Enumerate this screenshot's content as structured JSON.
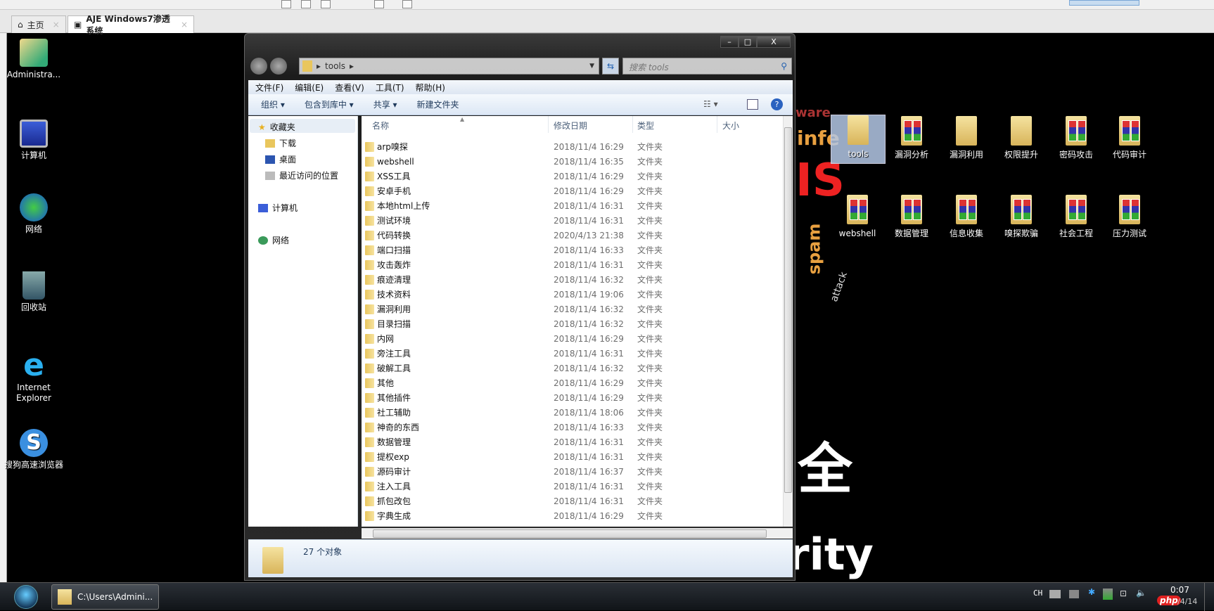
{
  "host": {
    "tabs": [
      {
        "label": "主页",
        "icon": "home-icon"
      },
      {
        "label": "AJE Windows7渗透系统",
        "icon": "vm-icon"
      }
    ]
  },
  "desktop_left": [
    {
      "label": "Administra..."
    },
    {
      "label": "计算机"
    },
    {
      "label": "网络"
    },
    {
      "label": "回收站"
    },
    {
      "label": "Internet Explorer"
    },
    {
      "label": "搜狗高速浏览器"
    }
  ],
  "desktop_right": [
    {
      "label": "tools",
      "selected": true
    },
    {
      "label": "漏洞分析"
    },
    {
      "label": "漏洞利用"
    },
    {
      "label": "权限提升"
    },
    {
      "label": "密码攻击"
    },
    {
      "label": "代码审计"
    },
    {
      "label": "webshell"
    },
    {
      "label": "数据管理"
    },
    {
      "label": "信息收集"
    },
    {
      "label": "嗅探欺骗"
    },
    {
      "label": "社会工程"
    },
    {
      "label": "压力测试"
    }
  ],
  "wallpaper": {
    "big_char": "全",
    "word": "rity",
    "cloud": [
      "infe",
      "IS",
      "spam",
      "attack",
      "ware"
    ]
  },
  "explorer": {
    "window_controls": {
      "minimize": "–",
      "maximize": "□",
      "close": "X"
    },
    "address": {
      "path": "tools",
      "separator": "▸"
    },
    "search_placeholder": "搜索 tools",
    "menu": [
      "文件(F)",
      "编辑(E)",
      "查看(V)",
      "工具(T)",
      "帮助(H)"
    ],
    "commands": [
      "组织 ▾",
      "包含到库中 ▾",
      "共享 ▾",
      "新建文件夹"
    ],
    "nav": {
      "favorites": "收藏夹",
      "items": [
        "下载",
        "桌面",
        "最近访问的位置"
      ],
      "computer": "计算机",
      "network": "网络"
    },
    "columns": [
      "名称",
      "修改日期",
      "类型",
      "大小"
    ],
    "files": [
      {
        "name": "arp嗅探",
        "date": "2018/11/4 16:29",
        "type": "文件夹"
      },
      {
        "name": "webshell",
        "date": "2018/11/4 16:35",
        "type": "文件夹"
      },
      {
        "name": "XSS工具",
        "date": "2018/11/4 16:29",
        "type": "文件夹"
      },
      {
        "name": "安卓手机",
        "date": "2018/11/4 16:29",
        "type": "文件夹"
      },
      {
        "name": "本地html上传",
        "date": "2018/11/4 16:31",
        "type": "文件夹"
      },
      {
        "name": "测试环境",
        "date": "2018/11/4 16:31",
        "type": "文件夹"
      },
      {
        "name": "代码转换",
        "date": "2020/4/13 21:38",
        "type": "文件夹"
      },
      {
        "name": "端口扫描",
        "date": "2018/11/4 16:33",
        "type": "文件夹"
      },
      {
        "name": "攻击轰炸",
        "date": "2018/11/4 16:31",
        "type": "文件夹"
      },
      {
        "name": "痕迹清理",
        "date": "2018/11/4 16:32",
        "type": "文件夹"
      },
      {
        "name": "技术资料",
        "date": "2018/11/4 19:06",
        "type": "文件夹"
      },
      {
        "name": "漏洞利用",
        "date": "2018/11/4 16:32",
        "type": "文件夹"
      },
      {
        "name": "目录扫描",
        "date": "2018/11/4 16:32",
        "type": "文件夹"
      },
      {
        "name": "内网",
        "date": "2018/11/4 16:29",
        "type": "文件夹"
      },
      {
        "name": "旁注工具",
        "date": "2018/11/4 16:31",
        "type": "文件夹"
      },
      {
        "name": "破解工具",
        "date": "2018/11/4 16:32",
        "type": "文件夹"
      },
      {
        "name": "其他",
        "date": "2018/11/4 16:29",
        "type": "文件夹"
      },
      {
        "name": "其他插件",
        "date": "2018/11/4 16:29",
        "type": "文件夹"
      },
      {
        "name": "社工辅助",
        "date": "2018/11/4 18:06",
        "type": "文件夹"
      },
      {
        "name": "神奇的东西",
        "date": "2018/11/4 16:33",
        "type": "文件夹"
      },
      {
        "name": "数据管理",
        "date": "2018/11/4 16:31",
        "type": "文件夹"
      },
      {
        "name": "提权exp",
        "date": "2018/11/4 16:31",
        "type": "文件夹"
      },
      {
        "name": "源码审计",
        "date": "2018/11/4 16:37",
        "type": "文件夹"
      },
      {
        "name": "注入工具",
        "date": "2018/11/4 16:31",
        "type": "文件夹"
      },
      {
        "name": "抓包改包",
        "date": "2018/11/4 16:31",
        "type": "文件夹"
      },
      {
        "name": "字典生成",
        "date": "2018/11/4 16:29",
        "type": "文件夹"
      }
    ],
    "status": "27 个对象"
  },
  "taskbar": {
    "button": "C:\\Users\\Admini...",
    "ime": "CH",
    "clock": "0:07",
    "date_partial": "/4/14",
    "watermark": "php"
  }
}
